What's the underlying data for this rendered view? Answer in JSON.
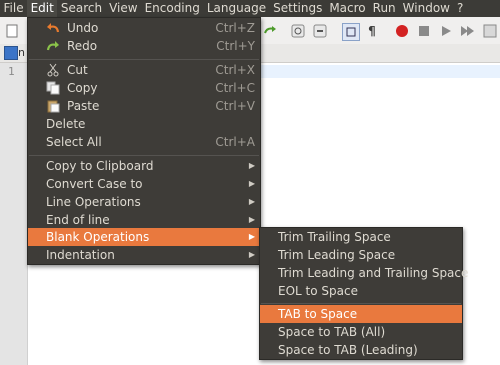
{
  "menubar": {
    "items": [
      "File",
      "Edit",
      "Search",
      "View",
      "Encoding",
      "Language",
      "Settings",
      "Macro",
      "Run",
      "Window",
      "?"
    ]
  },
  "editor": {
    "line_number": "1"
  },
  "edit_menu": {
    "items": [
      {
        "label": "Undo",
        "accel": "Ctrl+Z",
        "icon": "undo-icon"
      },
      {
        "label": "Redo",
        "accel": "Ctrl+Y",
        "icon": "redo-icon"
      },
      {
        "label": "Cut",
        "accel": "Ctrl+X",
        "icon": "cut-icon"
      },
      {
        "label": "Copy",
        "accel": "Ctrl+C",
        "icon": "copy-icon"
      },
      {
        "label": "Paste",
        "accel": "Ctrl+V",
        "icon": "paste-icon"
      },
      {
        "label": "Delete",
        "accel": ""
      },
      {
        "label": "Select All",
        "accel": "Ctrl+A"
      },
      {
        "label": "Copy to Clipboard",
        "submenu": true
      },
      {
        "label": "Convert Case to",
        "submenu": true
      },
      {
        "label": "Line Operations",
        "submenu": true
      },
      {
        "label": "End of line",
        "submenu": true
      },
      {
        "label": "Blank Operations",
        "submenu": true,
        "highlighted": true
      },
      {
        "label": "Indentation",
        "submenu": true
      }
    ]
  },
  "blank_submenu": {
    "items": [
      {
        "label": "Trim Trailing Space"
      },
      {
        "label": "Trim Leading Space"
      },
      {
        "label": "Trim Leading and Trailing Space"
      },
      {
        "label": "EOL to Space"
      },
      {
        "label": "TAB to Space",
        "highlighted": true
      },
      {
        "label": "Space to TAB (All)"
      },
      {
        "label": "Space to TAB (Leading)"
      }
    ]
  },
  "colors": {
    "menubar_bg": "#3c3b37",
    "menu_bg": "#3e3c38",
    "highlight": "#e9793e",
    "menu_text": "#dfdbd2"
  }
}
